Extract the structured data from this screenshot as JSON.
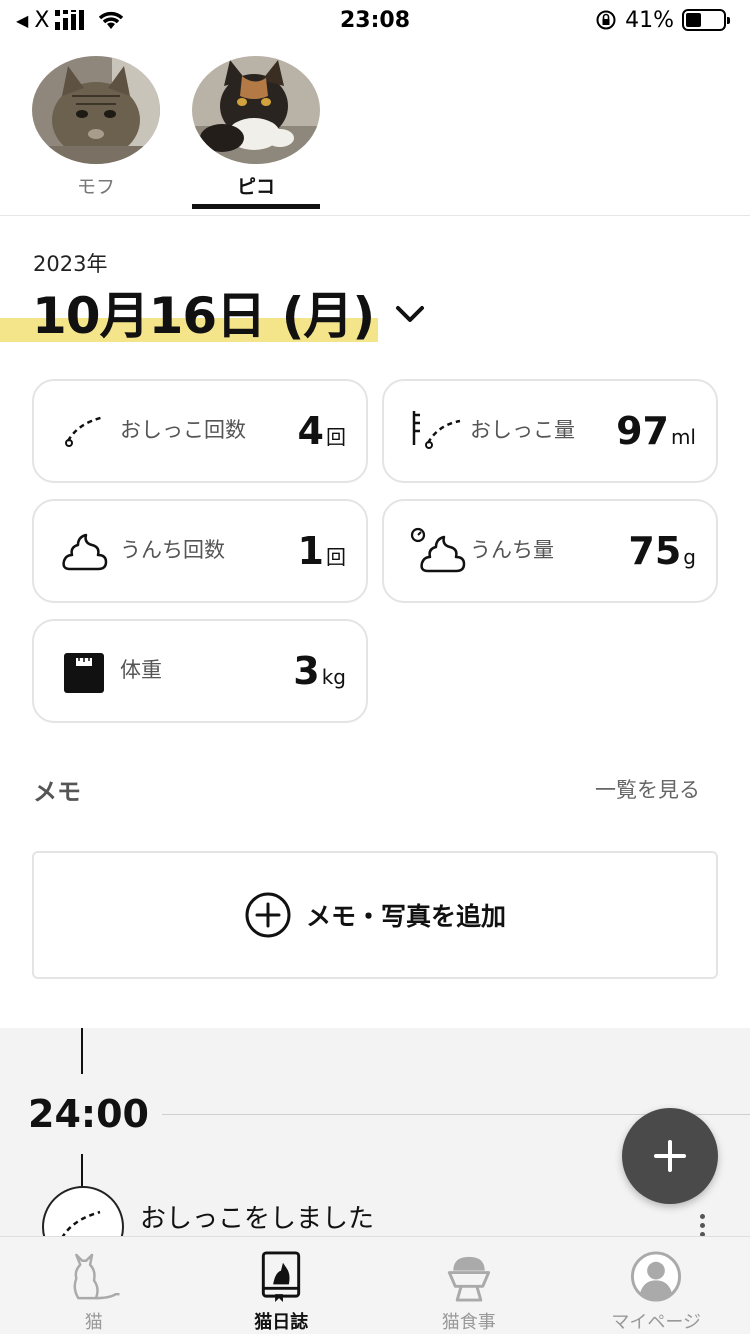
{
  "status_bar": {
    "carrier": "X",
    "time": "23:08",
    "battery_percent": "41%",
    "battery_level": 0.41
  },
  "cats": [
    {
      "name": "モフ",
      "active": false
    },
    {
      "name": "ピコ",
      "active": true
    }
  ],
  "date": {
    "year": "2023年",
    "day": "10月16日 (月)"
  },
  "stats": {
    "pee_count": {
      "label": "おしっこ回数",
      "value": "4",
      "unit": "回",
      "icon": "pee-icon"
    },
    "pee_amount": {
      "label": "おしっこ量",
      "value": "97",
      "unit": "ml",
      "icon": "pee-measure-icon"
    },
    "poop_count": {
      "label": "うんち回数",
      "value": "1",
      "unit": "回",
      "icon": "poop-icon"
    },
    "poop_amount": {
      "label": "うんち量",
      "value": "75",
      "unit": "g",
      "icon": "poop-measure-icon"
    },
    "weight": {
      "label": "体重",
      "value": "3",
      "unit": "kg",
      "icon": "scale-icon"
    }
  },
  "memo": {
    "title": "メモ",
    "view_all": "一覧を見る",
    "add_label": "メモ・写真を追加"
  },
  "timeline": {
    "time": "24:00",
    "event": "おしっこをしました"
  },
  "bottom_nav": [
    {
      "label": "猫",
      "icon": "cat-icon",
      "active": false
    },
    {
      "label": "猫日誌",
      "icon": "diary-icon",
      "active": true
    },
    {
      "label": "猫食事",
      "icon": "food-bowl-icon",
      "active": false
    },
    {
      "label": "マイページ",
      "icon": "user-icon",
      "active": false
    }
  ],
  "colors": {
    "highlight": "#f5e58a",
    "fab": "#4a4a4a",
    "text": "#111111"
  }
}
